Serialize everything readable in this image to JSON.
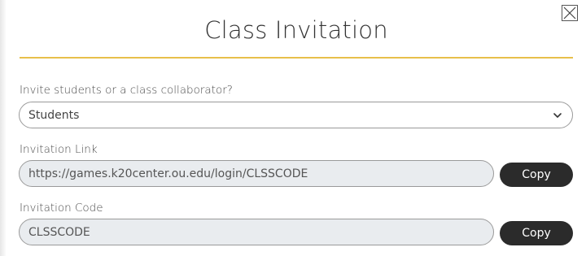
{
  "dialog": {
    "title": "Class Invitation",
    "close_icon": "close-icon",
    "accent_color": "#e8c04a"
  },
  "invite_type": {
    "label": "Invite students or a class collaborator?",
    "selected": "Students",
    "icon": "chevron-down-icon"
  },
  "invitation_link": {
    "label": "Invitation Link",
    "value": "https://games.k20center.ou.edu/login/CLSSCODE",
    "copy_label": "Copy"
  },
  "invitation_code": {
    "label": "Invitation Code",
    "value": "CLSSCODE",
    "copy_label": "Copy"
  }
}
